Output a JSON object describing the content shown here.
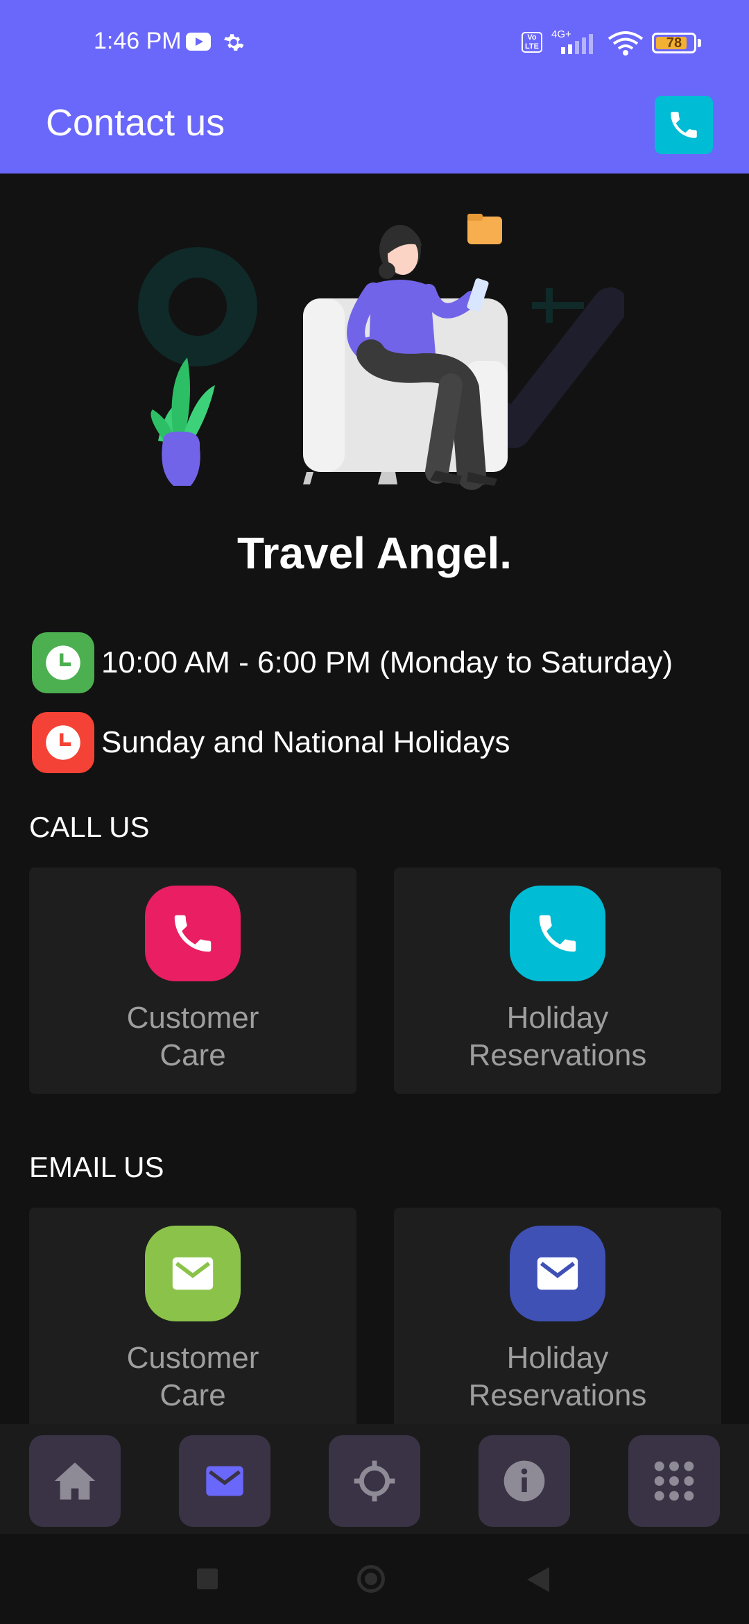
{
  "status_bar": {
    "time": "1:46 PM",
    "network": "4G+",
    "volte": "Vo LTE",
    "battery": "78"
  },
  "app_bar": {
    "title": "Contact us"
  },
  "brand": {
    "name": "Travel Angel."
  },
  "hours": [
    {
      "text": "10:00 AM - 6:00 PM (Monday to Saturday)",
      "color": "#4caf50"
    },
    {
      "text": "Sunday and National Holidays",
      "color": "#f44336"
    }
  ],
  "call_us": {
    "label": "CALL US",
    "cards": [
      {
        "line1": "Customer",
        "line2": "Care",
        "color": "#e91e63",
        "icon": "phone-icon"
      },
      {
        "line1": "Holiday",
        "line2": "Reservations",
        "color": "#00bcd4",
        "icon": "phone-icon"
      }
    ]
  },
  "email_us": {
    "label": "EMAIL US",
    "cards": [
      {
        "line1": "Customer",
        "line2": "Care",
        "color": "#8bc34a",
        "icon": "mail-icon"
      },
      {
        "line1": "Holiday",
        "line2": "Reservations",
        "color": "#3f51b5",
        "icon": "mail-icon"
      }
    ]
  },
  "bottom_nav": [
    {
      "name": "home",
      "icon": "home-icon",
      "active": false
    },
    {
      "name": "email",
      "icon": "mail-icon",
      "active": true
    },
    {
      "name": "location",
      "icon": "crosshair-icon",
      "active": false
    },
    {
      "name": "info",
      "icon": "info-icon",
      "active": false
    },
    {
      "name": "menu",
      "icon": "grid-icon",
      "active": false
    }
  ],
  "colors": {
    "primary": "#6a67fb",
    "background": "#121212",
    "card": "#1e1e1e"
  }
}
